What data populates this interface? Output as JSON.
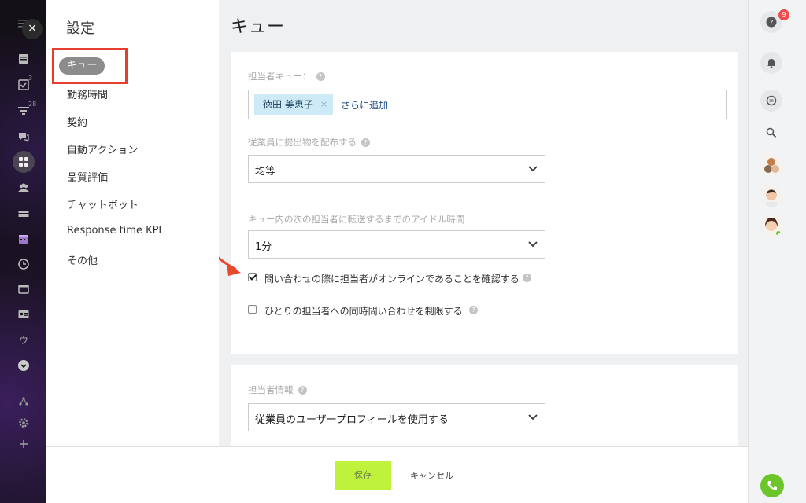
{
  "rail": {
    "close_icon": "×",
    "badges": {
      "tasks": "3",
      "filter": "28"
    },
    "letter_item": "ウ"
  },
  "nav": {
    "title": "設定",
    "items": [
      {
        "label": "キュー",
        "active": true
      },
      {
        "label": "勤務時間"
      },
      {
        "label": "契約"
      },
      {
        "label": "自動アクション"
      },
      {
        "label": "品質評価"
      },
      {
        "label": "チャットボット"
      },
      {
        "label": "Response time KPI"
      },
      {
        "label": "その他"
      }
    ]
  },
  "main": {
    "title": "キュー",
    "queue_label": "担当者キュー：",
    "queue_tag": "徳田 美恵子",
    "queue_tag_remove": "×",
    "add_more": "さらに追加",
    "distribute_label": "従業員に提出物を配布する",
    "distribute_value": "均等",
    "idle_label": "キュー内の次の担当者に転送するまでのアイドル時間",
    "idle_value": "1分",
    "check_online": {
      "label": "問い合わせの際に担当者がオンラインであることを確認する",
      "checked": true
    },
    "check_limit": {
      "label": "ひとりの担当者への同時問い合わせを制限する",
      "checked": false
    },
    "agent_info_label": "担当者情報",
    "agent_info_value": "従業員のユーザープロフィールを使用する",
    "help_glyph": "?"
  },
  "footer": {
    "save_label": "保存",
    "cancel_label": "キャンセル"
  },
  "right_rail": {
    "help_badge": "9"
  },
  "colors": {
    "accent_save": "#bff23a",
    "highlight_box": "#e73d2c",
    "tag_bg": "#cdeaf6",
    "phone": "#6cc62a"
  }
}
